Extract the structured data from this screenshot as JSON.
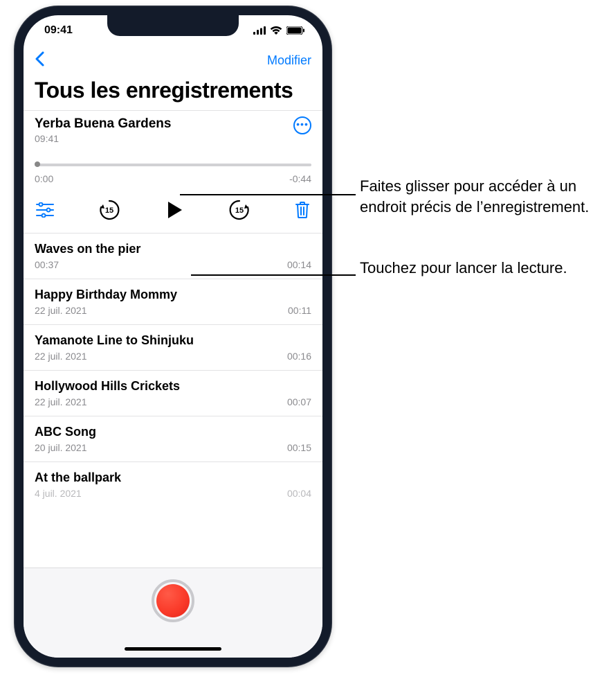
{
  "status": {
    "time": "09:41"
  },
  "nav": {
    "edit": "Modifier"
  },
  "title": "Tous les enregistrements",
  "expanded": {
    "title": "Yerba Buena Gardens",
    "subtitle": "09:41",
    "elapsed": "0:00",
    "remaining": "-0:44",
    "skip_amount": "15"
  },
  "recordings": [
    {
      "title": "Waves on the pier",
      "meta": "00:37",
      "dur": "00:14"
    },
    {
      "title": "Happy Birthday Mommy",
      "meta": "22 juil. 2021",
      "dur": "00:11"
    },
    {
      "title": "Yamanote Line to Shinjuku",
      "meta": "22 juil. 2021",
      "dur": "00:16"
    },
    {
      "title": "Hollywood Hills Crickets",
      "meta": "22 juil. 2021",
      "dur": "00:07"
    },
    {
      "title": "ABC Song",
      "meta": "20 juil. 2021",
      "dur": "00:15"
    },
    {
      "title": "At the ballpark",
      "meta": "4 juil. 2021",
      "dur": "00:04"
    }
  ],
  "callouts": {
    "slider": "Faites glisser pour accéder à un endroit précis de l’enregistrement.",
    "play": "Touchez pour lancer la lecture."
  }
}
